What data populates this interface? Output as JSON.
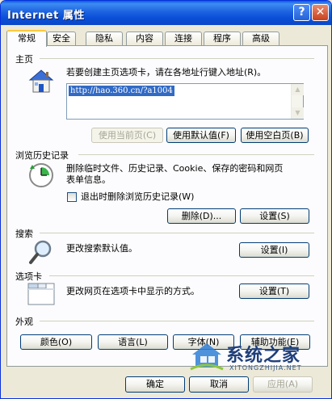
{
  "window": {
    "title": "Internet 属性",
    "help": "?",
    "close": "✕"
  },
  "tabs": [
    "常规",
    "安全",
    "隐私",
    "内容",
    "连接",
    "程序",
    "高级"
  ],
  "home": {
    "heading": "主页",
    "instruction": "若要创建主页选项卡，请在各地址行键入地址(R)。",
    "url": "http://hao.360.cn/?a1004",
    "btn_current": "使用当前页(C)",
    "btn_default": "使用默认值(F)",
    "btn_blank": "使用空白页(B)"
  },
  "history": {
    "heading": "浏览历史记录",
    "desc_line1": "删除临时文件、历史记录、Cookie、保存的密码和网页",
    "desc_line2": "表单信息。",
    "checkbox_label": "退出时删除浏览历史记录(W)",
    "btn_delete": "删除(D)...",
    "btn_settings": "设置(S)"
  },
  "search": {
    "heading": "搜索",
    "desc": "更改搜索默认值。",
    "btn_settings": "设置(I)"
  },
  "tabs_section": {
    "heading": "选项卡",
    "desc": "更改网页在选项卡中显示的方式。",
    "btn_settings": "设置(T)"
  },
  "appearance": {
    "heading": "外观",
    "btn_colors": "颜色(O)",
    "btn_languages": "语言(L)",
    "btn_fonts": "字体(N)",
    "btn_accessibility": "辅助功能(E)"
  },
  "footer": {
    "ok": "确定",
    "cancel": "取消",
    "apply": "应用(A)"
  },
  "watermark": {
    "name": "系统之家",
    "url": "XITONGZHIJIA.NET"
  }
}
